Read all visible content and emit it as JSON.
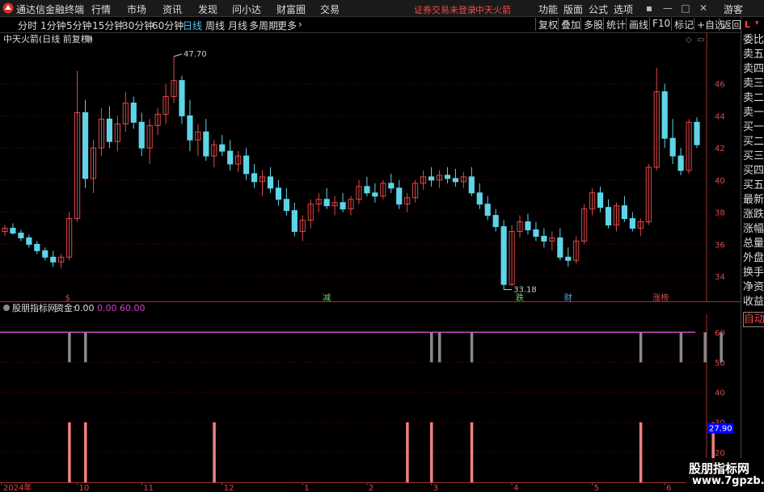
{
  "app": {
    "title": "通达信金融终端",
    "menu": [
      "行情",
      "市场",
      "资讯",
      "发现",
      "问小达",
      "财富圈",
      "交易"
    ],
    "warning": "证券交易未登录",
    "stock_name_top": "中天火箭",
    "right_menu": [
      "功能",
      "版面",
      "公式",
      "选项"
    ],
    "user": "游客",
    "colors": {
      "up": "#e04848",
      "down": "#5fd4e8",
      "grid": "#3a0000",
      "axis": "#a03030",
      "purple": "#cc44cc"
    }
  },
  "periodbar": {
    "periods": [
      "分时",
      "1分钟",
      "5分钟",
      "15分钟",
      "30分钟",
      "60分钟",
      "日线",
      "周线",
      "月线",
      "多周期",
      "更多"
    ],
    "active": "日线",
    "tools": [
      "复权",
      "叠加",
      "多股",
      "统计",
      "画线",
      "F10",
      "标记",
      "+自选",
      "返回"
    ]
  },
  "right_panel": {
    "top_label": "L",
    "items": [
      "委比",
      "卖五",
      "卖四",
      "卖三",
      "卖二",
      "卖一",
      "买一",
      "买二",
      "买三",
      "买四",
      "买五",
      "最新",
      "涨跌",
      "涨幅",
      "总量",
      "外盘",
      "换手",
      "净资",
      "收益"
    ],
    "selected": "自动"
  },
  "main_chart": {
    "title": "中天火箭(日线 前复权)",
    "high_label": "47.70",
    "low_label": "33.18",
    "event_markers": [
      {
        "label": "$",
        "color": "#e04848",
        "idx": 8
      },
      {
        "label": "减",
        "color": "#66dd66",
        "idx": 40
      },
      {
        "label": "跌",
        "color": "#66dd66",
        "idx": 64
      },
      {
        "label": "财",
        "color": "#5fa8e8",
        "idx": 70
      },
      {
        "label": "涨榜",
        "color": "#e04848",
        "idx": 81
      }
    ]
  },
  "indicator": {
    "name": "股朋指标网",
    "series_label": "资金:",
    "v1": "0.00",
    "v2": "0.00",
    "v3": "60.00",
    "current_value": "27.90"
  },
  "chart_data": [
    {
      "type": "candlestick",
      "title": "中天火箭(日线 前复权)",
      "ylim": [
        32.8,
        49.0
      ],
      "yticks": [
        34.0,
        36.0,
        38.0,
        40.0,
        42.0,
        44.0,
        46.0
      ],
      "x_labels": [
        {
          "label": "2024年",
          "idx": 0
        },
        {
          "label": "10",
          "idx": 9
        },
        {
          "label": "11",
          "idx": 17
        },
        {
          "label": "12",
          "idx": 27
        },
        {
          "label": "1",
          "idx": 37
        },
        {
          "label": "2",
          "idx": 45
        },
        {
          "label": "3",
          "idx": 53
        },
        {
          "label": "4",
          "idx": 63
        },
        {
          "label": "5",
          "idx": 73
        },
        {
          "label": "6",
          "idx": 82
        }
      ],
      "ohlc": [
        [
          36.8,
          37.2,
          36.5,
          37.0
        ],
        [
          37.0,
          37.3,
          36.6,
          36.7
        ],
        [
          36.7,
          36.9,
          36.2,
          36.4
        ],
        [
          36.4,
          36.6,
          35.8,
          36.0
        ],
        [
          36.0,
          36.2,
          35.4,
          35.6
        ],
        [
          35.6,
          35.8,
          35.0,
          35.2
        ],
        [
          35.2,
          35.6,
          34.6,
          34.9
        ],
        [
          34.9,
          35.4,
          34.5,
          35.2
        ],
        [
          35.2,
          38.0,
          35.0,
          37.6
        ],
        [
          37.6,
          46.8,
          37.4,
          44.2
        ],
        [
          44.2,
          45.0,
          39.5,
          40.1
        ],
        [
          40.1,
          42.5,
          39.2,
          42.0
        ],
        [
          42.0,
          44.5,
          41.5,
          43.8
        ],
        [
          43.8,
          44.6,
          42.0,
          42.4
        ],
        [
          42.4,
          44.0,
          41.8,
          43.5
        ],
        [
          43.5,
          45.5,
          43.0,
          44.8
        ],
        [
          44.8,
          45.2,
          43.2,
          43.6
        ],
        [
          43.6,
          44.2,
          41.5,
          42.0
        ],
        [
          42.0,
          43.8,
          41.0,
          43.4
        ],
        [
          43.4,
          44.5,
          42.8,
          44.1
        ],
        [
          44.1,
          46.0,
          43.5,
          45.2
        ],
        [
          45.2,
          47.7,
          44.8,
          46.2
        ],
        [
          46.2,
          46.5,
          43.5,
          44.0
        ],
        [
          44.0,
          45.0,
          41.8,
          42.5
        ],
        [
          42.5,
          43.5,
          41.5,
          43.0
        ],
        [
          43.0,
          43.8,
          41.2,
          41.5
        ],
        [
          41.5,
          42.5,
          40.8,
          42.2
        ],
        [
          42.2,
          42.8,
          41.5,
          41.8
        ],
        [
          41.8,
          42.5,
          40.6,
          41.0
        ],
        [
          41.0,
          41.8,
          40.5,
          41.5
        ],
        [
          41.5,
          42.0,
          40.0,
          40.4
        ],
        [
          40.4,
          41.0,
          39.5,
          39.9
        ],
        [
          39.9,
          40.6,
          39.0,
          40.2
        ],
        [
          40.2,
          40.8,
          39.2,
          39.5
        ],
        [
          39.5,
          40.0,
          38.4,
          38.8
        ],
        [
          38.8,
          39.5,
          37.8,
          38.1
        ],
        [
          38.1,
          38.6,
          36.5,
          36.8
        ],
        [
          36.8,
          37.8,
          36.2,
          37.5
        ],
        [
          37.5,
          38.8,
          37.0,
          38.5
        ],
        [
          38.5,
          39.2,
          38.0,
          38.8
        ],
        [
          38.8,
          39.5,
          38.2,
          38.4
        ],
        [
          38.4,
          39.0,
          37.8,
          38.6
        ],
        [
          38.6,
          39.2,
          38.0,
          38.2
        ],
        [
          38.2,
          39.0,
          37.8,
          38.8
        ],
        [
          38.8,
          40.0,
          38.5,
          39.6
        ],
        [
          39.6,
          40.2,
          39.0,
          39.2
        ],
        [
          39.2,
          39.8,
          38.6,
          39.0
        ],
        [
          39.0,
          40.0,
          38.8,
          39.8
        ],
        [
          39.8,
          40.4,
          39.2,
          39.5
        ],
        [
          39.5,
          40.0,
          38.2,
          38.5
        ],
        [
          38.5,
          39.2,
          38.0,
          38.9
        ],
        [
          38.9,
          40.0,
          38.6,
          39.8
        ],
        [
          39.8,
          40.6,
          39.4,
          40.2
        ],
        [
          40.2,
          40.8,
          39.6,
          40.0
        ],
        [
          40.0,
          40.6,
          39.5,
          40.3
        ],
        [
          40.3,
          40.8,
          39.8,
          40.1
        ],
        [
          40.1,
          40.7,
          39.6,
          39.9
        ],
        [
          39.9,
          40.5,
          39.5,
          40.2
        ],
        [
          40.2,
          40.8,
          39.0,
          39.2
        ],
        [
          39.2,
          39.8,
          38.2,
          38.5
        ],
        [
          38.5,
          39.0,
          37.5,
          37.8
        ],
        [
          37.8,
          38.2,
          36.8,
          37.1
        ],
        [
          37.1,
          37.5,
          33.18,
          33.5
        ],
        [
          33.5,
          37.2,
          33.4,
          36.8
        ],
        [
          36.8,
          37.8,
          36.4,
          37.4
        ],
        [
          37.4,
          37.9,
          36.6,
          36.9
        ],
        [
          36.9,
          37.4,
          36.2,
          36.5
        ],
        [
          36.5,
          37.0,
          35.8,
          36.2
        ],
        [
          36.2,
          36.8,
          35.6,
          36.4
        ],
        [
          36.4,
          37.0,
          35.0,
          35.2
        ],
        [
          35.2,
          35.8,
          34.6,
          35.0
        ],
        [
          35.0,
          36.5,
          34.8,
          36.2
        ],
        [
          36.2,
          38.5,
          36.0,
          38.2
        ],
        [
          38.2,
          39.5,
          37.8,
          39.2
        ],
        [
          39.2,
          39.6,
          38.0,
          38.3
        ],
        [
          38.3,
          38.8,
          37.0,
          37.2
        ],
        [
          37.2,
          38.6,
          36.8,
          38.4
        ],
        [
          38.4,
          39.0,
          37.4,
          37.6
        ],
        [
          37.6,
          38.0,
          36.8,
          37.0
        ],
        [
          37.0,
          37.6,
          36.5,
          37.4
        ],
        [
          37.4,
          41.0,
          37.2,
          40.8
        ],
        [
          40.8,
          47.0,
          40.6,
          45.5
        ],
        [
          45.5,
          46.0,
          42.0,
          42.6
        ],
        [
          42.6,
          43.8,
          41.0,
          41.5
        ],
        [
          41.5,
          42.0,
          40.3,
          40.6
        ],
        [
          40.6,
          43.8,
          40.4,
          43.6
        ],
        [
          43.6,
          43.9,
          42.0,
          42.2
        ]
      ]
    },
    {
      "type": "bar",
      "name": "资金",
      "ylim": [
        10,
        66
      ],
      "yticks": [
        20.0,
        30.0,
        40.0,
        50.0,
        60.0
      ],
      "reference_line": 60.0,
      "gray_bars": [
        {
          "idx": 8,
          "from": 50,
          "to": 60
        },
        {
          "idx": 10,
          "from": 50,
          "to": 60
        },
        {
          "idx": 53,
          "from": 50,
          "to": 60
        },
        {
          "idx": 54,
          "from": 50,
          "to": 60
        },
        {
          "idx": 58,
          "from": 50,
          "to": 60
        },
        {
          "idx": 79,
          "from": 50,
          "to": 60
        },
        {
          "idx": 84,
          "from": 50,
          "to": 60
        },
        {
          "idx": 87,
          "from": 50,
          "to": 60
        },
        {
          "idx": 89,
          "from": 50,
          "to": 60
        }
      ],
      "pink_bars": [
        {
          "idx": 8,
          "from": 10,
          "to": 30
        },
        {
          "idx": 10,
          "from": 10,
          "to": 30
        },
        {
          "idx": 26,
          "from": 10,
          "to": 30
        },
        {
          "idx": 50,
          "from": 10,
          "to": 30
        },
        {
          "idx": 53,
          "from": 10,
          "to": 30
        },
        {
          "idx": 58,
          "from": 10,
          "to": 30
        },
        {
          "idx": 79,
          "from": 10,
          "to": 30
        },
        {
          "idx": 88,
          "from": 10,
          "to": 30
        }
      ]
    }
  ],
  "watermark": {
    "line1": "股朋指标网",
    "line2": "www.7gpzb.com"
  }
}
